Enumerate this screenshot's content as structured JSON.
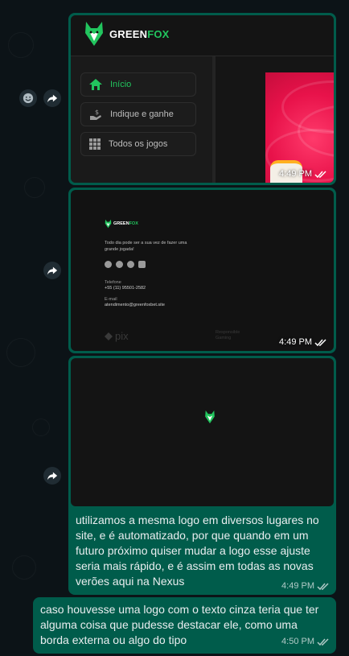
{
  "colors": {
    "chat_background": "#0c1317",
    "outgoing_bubble": "#005c4b",
    "brand_green": "#22c55e",
    "banner_red": "#e8124a"
  },
  "messages": [
    {
      "type": "image",
      "time": "4:49 PM",
      "status": "read-ticks",
      "content": {
        "brand_part1": "GREEN",
        "brand_part2": "FOX",
        "nav": [
          {
            "label": "Início",
            "icon": "home-icon",
            "active": true
          },
          {
            "label": "Indique e ganhe",
            "icon": "money-hand-icon",
            "active": false
          },
          {
            "label": "Todos os jogos",
            "icon": "grid-icon",
            "active": false
          }
        ]
      }
    },
    {
      "type": "image",
      "time": "4:49 PM",
      "status": "read-ticks",
      "content": {
        "brand_part1": "GREEN",
        "brand_part2": "FOX",
        "tagline": "Todo dia pode ser a sua vez de fazer uma grande jogada!",
        "phone_label": "Telefone",
        "phone_value": "+55 (11) 95501-2582",
        "email_label": "E-mail",
        "email_value": "atendimento@greenfoxbet.site",
        "payment_label": "pix",
        "responsible_label": "Responsible Gaming"
      }
    },
    {
      "type": "image-with-caption",
      "time": "4:49 PM",
      "status": "read-ticks",
      "caption": "utilizamos a mesma logo em diversos lugares no site, e é automatizado, por que quando em um futuro próximo quiser mudar a logo esse ajuste seria mais rápido, e é assim em todas as novas verões aqui na Nexus"
    },
    {
      "type": "text",
      "time": "4:50 PM",
      "status": "read-ticks",
      "text": "caso houvesse uma logo com o texto cinza teria que ter alguma coisa que pudesse destacar ele, como uma borda externa ou algo do tipo"
    }
  ]
}
